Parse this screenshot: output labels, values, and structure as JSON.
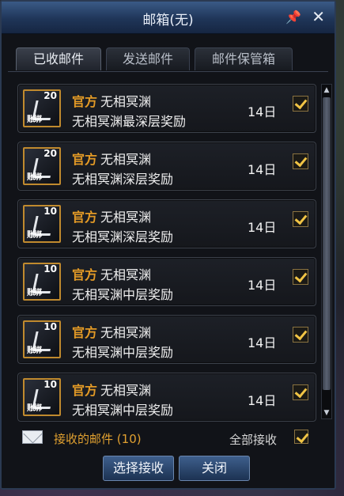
{
  "window": {
    "title": "邮箱(无)"
  },
  "tabs": [
    {
      "label": "已收邮件"
    },
    {
      "label": "发送邮件"
    },
    {
      "label": "邮件保管箱"
    }
  ],
  "mails": [
    {
      "count": "20",
      "seal": "账绑",
      "official": "官方",
      "sender": "无相冥渊",
      "subject": "无相冥渊最深层奖励",
      "days": "14日"
    },
    {
      "count": "20",
      "seal": "账绑",
      "official": "官方",
      "sender": "无相冥渊",
      "subject": "无相冥渊深层奖励",
      "days": "14日"
    },
    {
      "count": "10",
      "seal": "账绑",
      "official": "官方",
      "sender": "无相冥渊",
      "subject": "无相冥渊深层奖励",
      "days": "14日"
    },
    {
      "count": "10",
      "seal": "账绑",
      "official": "官方",
      "sender": "无相冥渊",
      "subject": "无相冥渊中层奖励",
      "days": "14日"
    },
    {
      "count": "10",
      "seal": "账绑",
      "official": "官方",
      "sender": "无相冥渊",
      "subject": "无相冥渊中层奖励",
      "days": "14日"
    },
    {
      "count": "10",
      "seal": "账绑",
      "official": "官方",
      "sender": "无相冥渊",
      "subject": "无相冥渊中层奖励",
      "days": "14日"
    }
  ],
  "footer": {
    "received_label": "接收的邮件",
    "received_count": "(10)",
    "accept_all_label": "全部接收",
    "select_receive_button": "选择接收",
    "close_button": "关闭"
  },
  "colors": {
    "title_bar": "#1f3558",
    "official_text": "#e39a26",
    "checkmark": "#f1c445",
    "received_text": "#e0a030"
  }
}
